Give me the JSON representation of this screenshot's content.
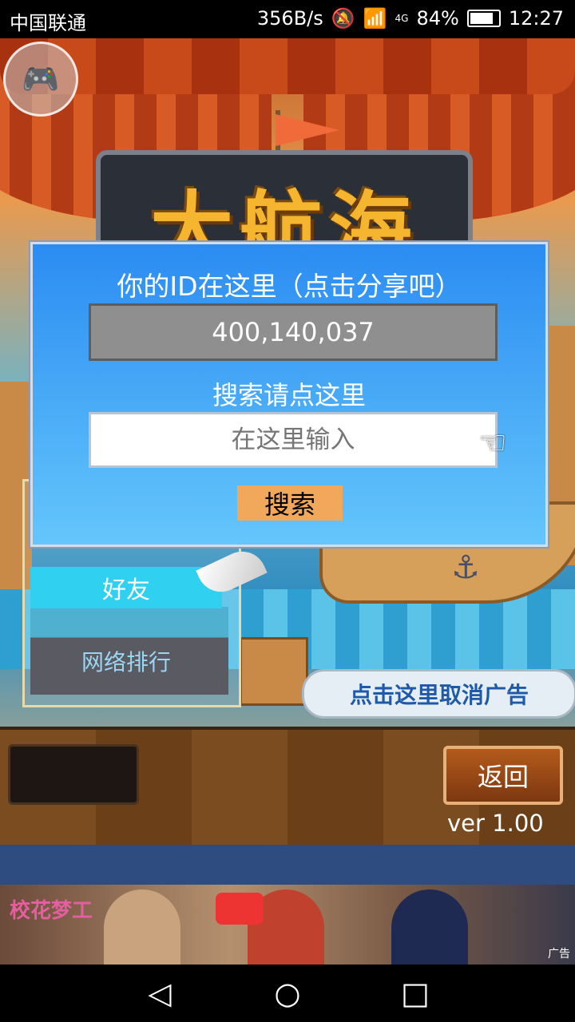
{
  "status_bar": {
    "carrier": "中国联通",
    "speed": "356B/s",
    "network": "4G",
    "battery": "84%",
    "time": "12:27"
  },
  "game": {
    "title": "大航海",
    "dialog": {
      "title": "你的ID在这里（点击分享吧）",
      "id_value": "400,140,037",
      "search_prompt": "搜索请点这里",
      "search_placeholder": "在这里输入",
      "search_button": "搜索"
    },
    "side_panel": {
      "friends_label": "好友",
      "ranking_label": "网络排行"
    },
    "cancel_ad_label": "点击这里取消广告",
    "back_button": "返回",
    "version": "ver 1.00"
  },
  "ad": {
    "logo": "校花梦工",
    "label": "广告"
  },
  "icons": {
    "gamepad": "gamepad-icon",
    "hand": "pointing-hand-icon",
    "anchor": "anchor-icon"
  },
  "colors": {
    "dialog_top": "#2b8cf2",
    "dialog_bottom": "#64c6fb",
    "search_button": "#f1a85a",
    "friend_tab": "#2fd0f0"
  }
}
